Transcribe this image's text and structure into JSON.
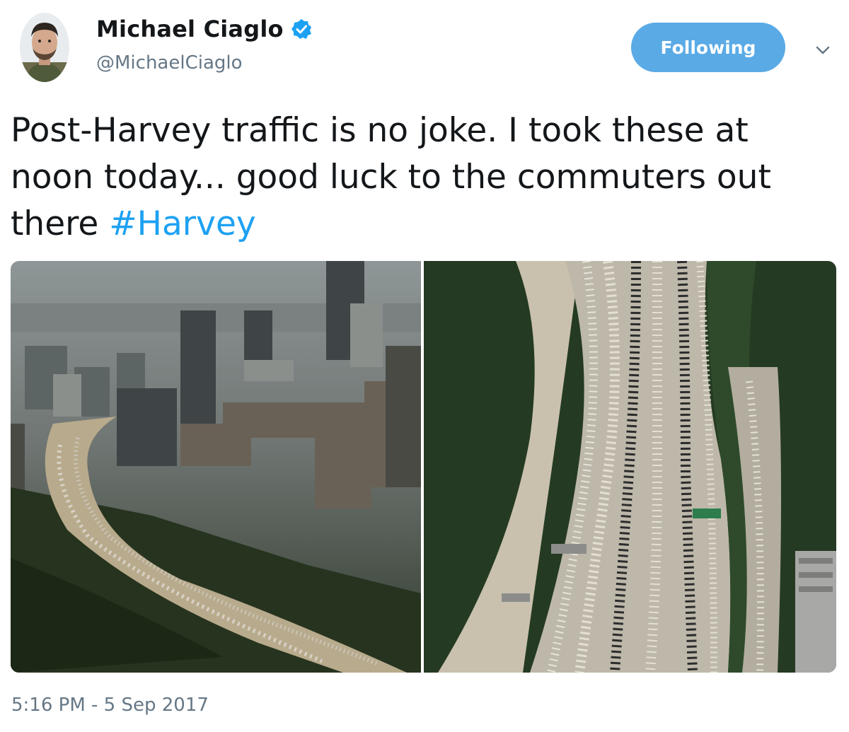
{
  "user": {
    "display_name": "Michael Ciaglo",
    "handle": "@MichaelCiaglo",
    "verified_icon": "verified-badge-icon",
    "avatar_icon": "user-avatar"
  },
  "actions": {
    "follow_label": "Following",
    "menu_icon": "chevron-down-icon"
  },
  "tweet": {
    "text": "Post-Harvey traffic is no joke. I took these at noon today... good luck to the commuters out there ",
    "hashtag": "#Harvey",
    "timestamp": "5:16 PM - 5 Sep 2017"
  },
  "colors": {
    "follow_button": "#5aaae6",
    "hashtag": "#1da1f2",
    "secondary_text": "#657786"
  }
}
